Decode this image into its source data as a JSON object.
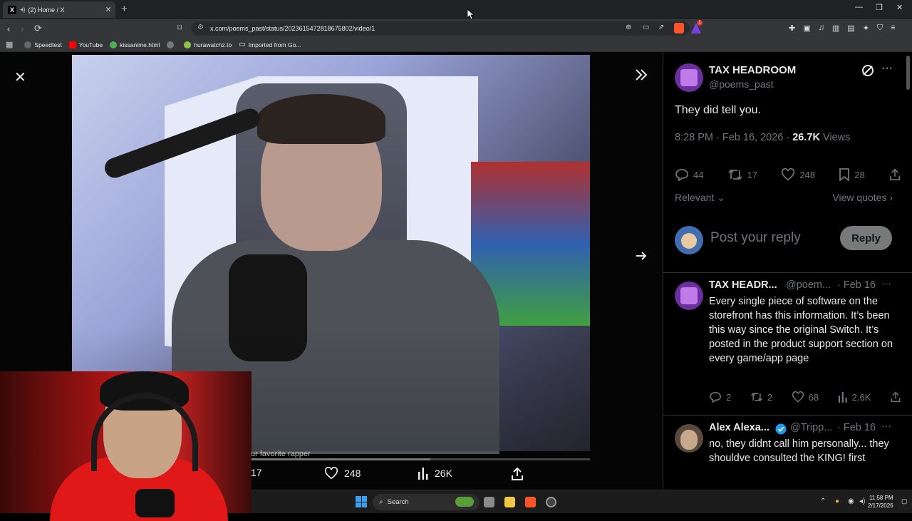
{
  "browser": {
    "tab_title": "(2) Home / X",
    "tab_favicon": "X",
    "url": "x.com/poems_past/status/2023615472818675802/video/1",
    "bookmarks": [
      "Speedtest",
      "YouTube",
      "kissanime.html",
      "hurawatchz.to",
      "Imported from Go..."
    ],
    "shield_badge": "1"
  },
  "viewer": {
    "caption": "ur favorite rapper",
    "progress_fraction": 0.53,
    "stats": {
      "retweets": "17",
      "likes": "248",
      "views": "26K"
    }
  },
  "tweet": {
    "author_name": "TAX HEADROOM",
    "author_handle": "@poems_past",
    "text": "They did tell you.",
    "time": "8:28 PM · Feb 16, 2026 · ",
    "views_count": "26.7K",
    "views_label": " Views",
    "replies": "44",
    "retweets": "17",
    "likes": "248",
    "bookmarks": "28",
    "sort_label": "Relevant",
    "view_quotes": "View quotes",
    "reply_placeholder": "Post your reply",
    "reply_button": "Reply"
  },
  "replies": [
    {
      "name": "TAX HEADR...",
      "handle": "@poem...",
      "date": "· Feb 16",
      "text": "Every single piece of software on the storefront has this information. It’s been this way since the original Switch. It’s posted in the product support section on every game/app page",
      "replies": "2",
      "retweets": "2",
      "likes": "68",
      "views": "2.6K"
    },
    {
      "name": "Alex Alexa...",
      "handle": "@Tripp...",
      "date": "· Feb 16",
      "text": "no, they didnt call him personally... they shouldve consulted the KING! first"
    }
  ],
  "taskbar": {
    "search_label": "Search",
    "time": "11:58 PM",
    "date": "2/17/2026"
  },
  "colors": {
    "x_blue": "#1d9bf0",
    "reply_button_bg": "#787a7a",
    "muted_text": "#71767b",
    "browser_frame": "#35363a",
    "brave_orange": "#fb542b"
  }
}
